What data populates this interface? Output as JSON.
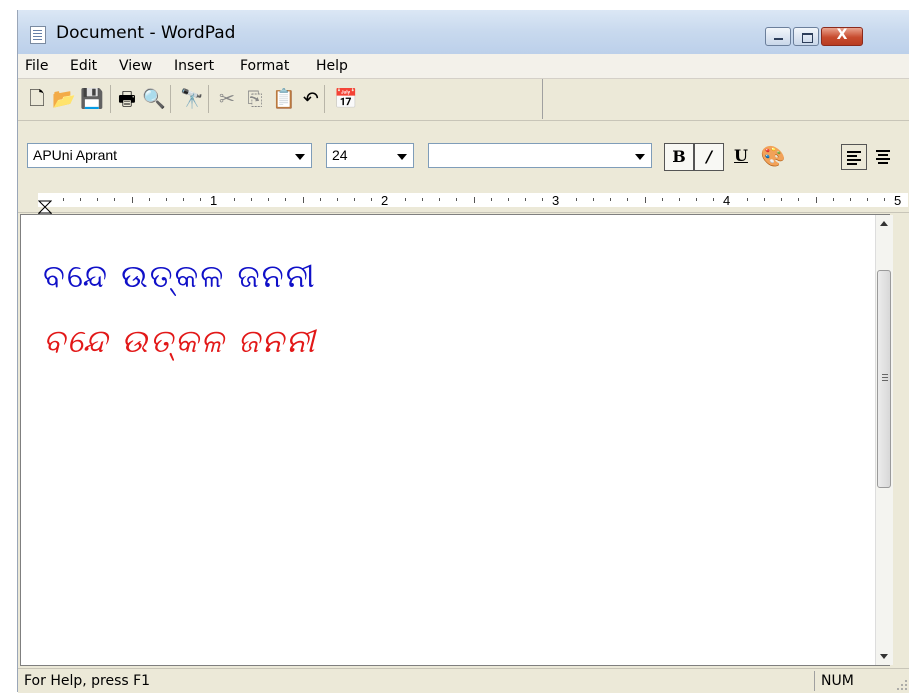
{
  "window": {
    "title": "Document - WordPad",
    "close_glyph": "X"
  },
  "menu": [
    {
      "name": "menu-file",
      "label": "File"
    },
    {
      "name": "menu-edit",
      "label": "Edit"
    },
    {
      "name": "menu-view",
      "label": "View"
    },
    {
      "name": "menu-insert",
      "label": "Insert"
    },
    {
      "name": "menu-format",
      "label": "Format"
    },
    {
      "name": "menu-help",
      "label": "Help"
    }
  ],
  "toolbar": {
    "icons": [
      "new-document-icon",
      "open-folder-icon",
      "save-disk-icon",
      "print-icon",
      "print-preview-icon",
      "find-binoculars-icon",
      "cut-scissors-icon",
      "copy-icon",
      "paste-icon",
      "undo-icon",
      "insert-datetime-icon"
    ]
  },
  "format": {
    "font": "APUni Aprant",
    "size": "24",
    "script": "",
    "bold_label": "B",
    "italic_label": "/",
    "underline_label": "U"
  },
  "ruler": {
    "numbers": [
      "1",
      "2",
      "3",
      "4",
      "5"
    ]
  },
  "document": {
    "line1": "ବନ୍ଦେ ଉତ୍କଳ ଜନନୀ",
    "line1_color": "#1010c8",
    "line2": "ବନ୍ଦେ ଉତ୍କଳ ଜନନୀ",
    "line2_color": "#e21818"
  },
  "status": {
    "help": "For Help, press F1",
    "num": "NUM"
  }
}
